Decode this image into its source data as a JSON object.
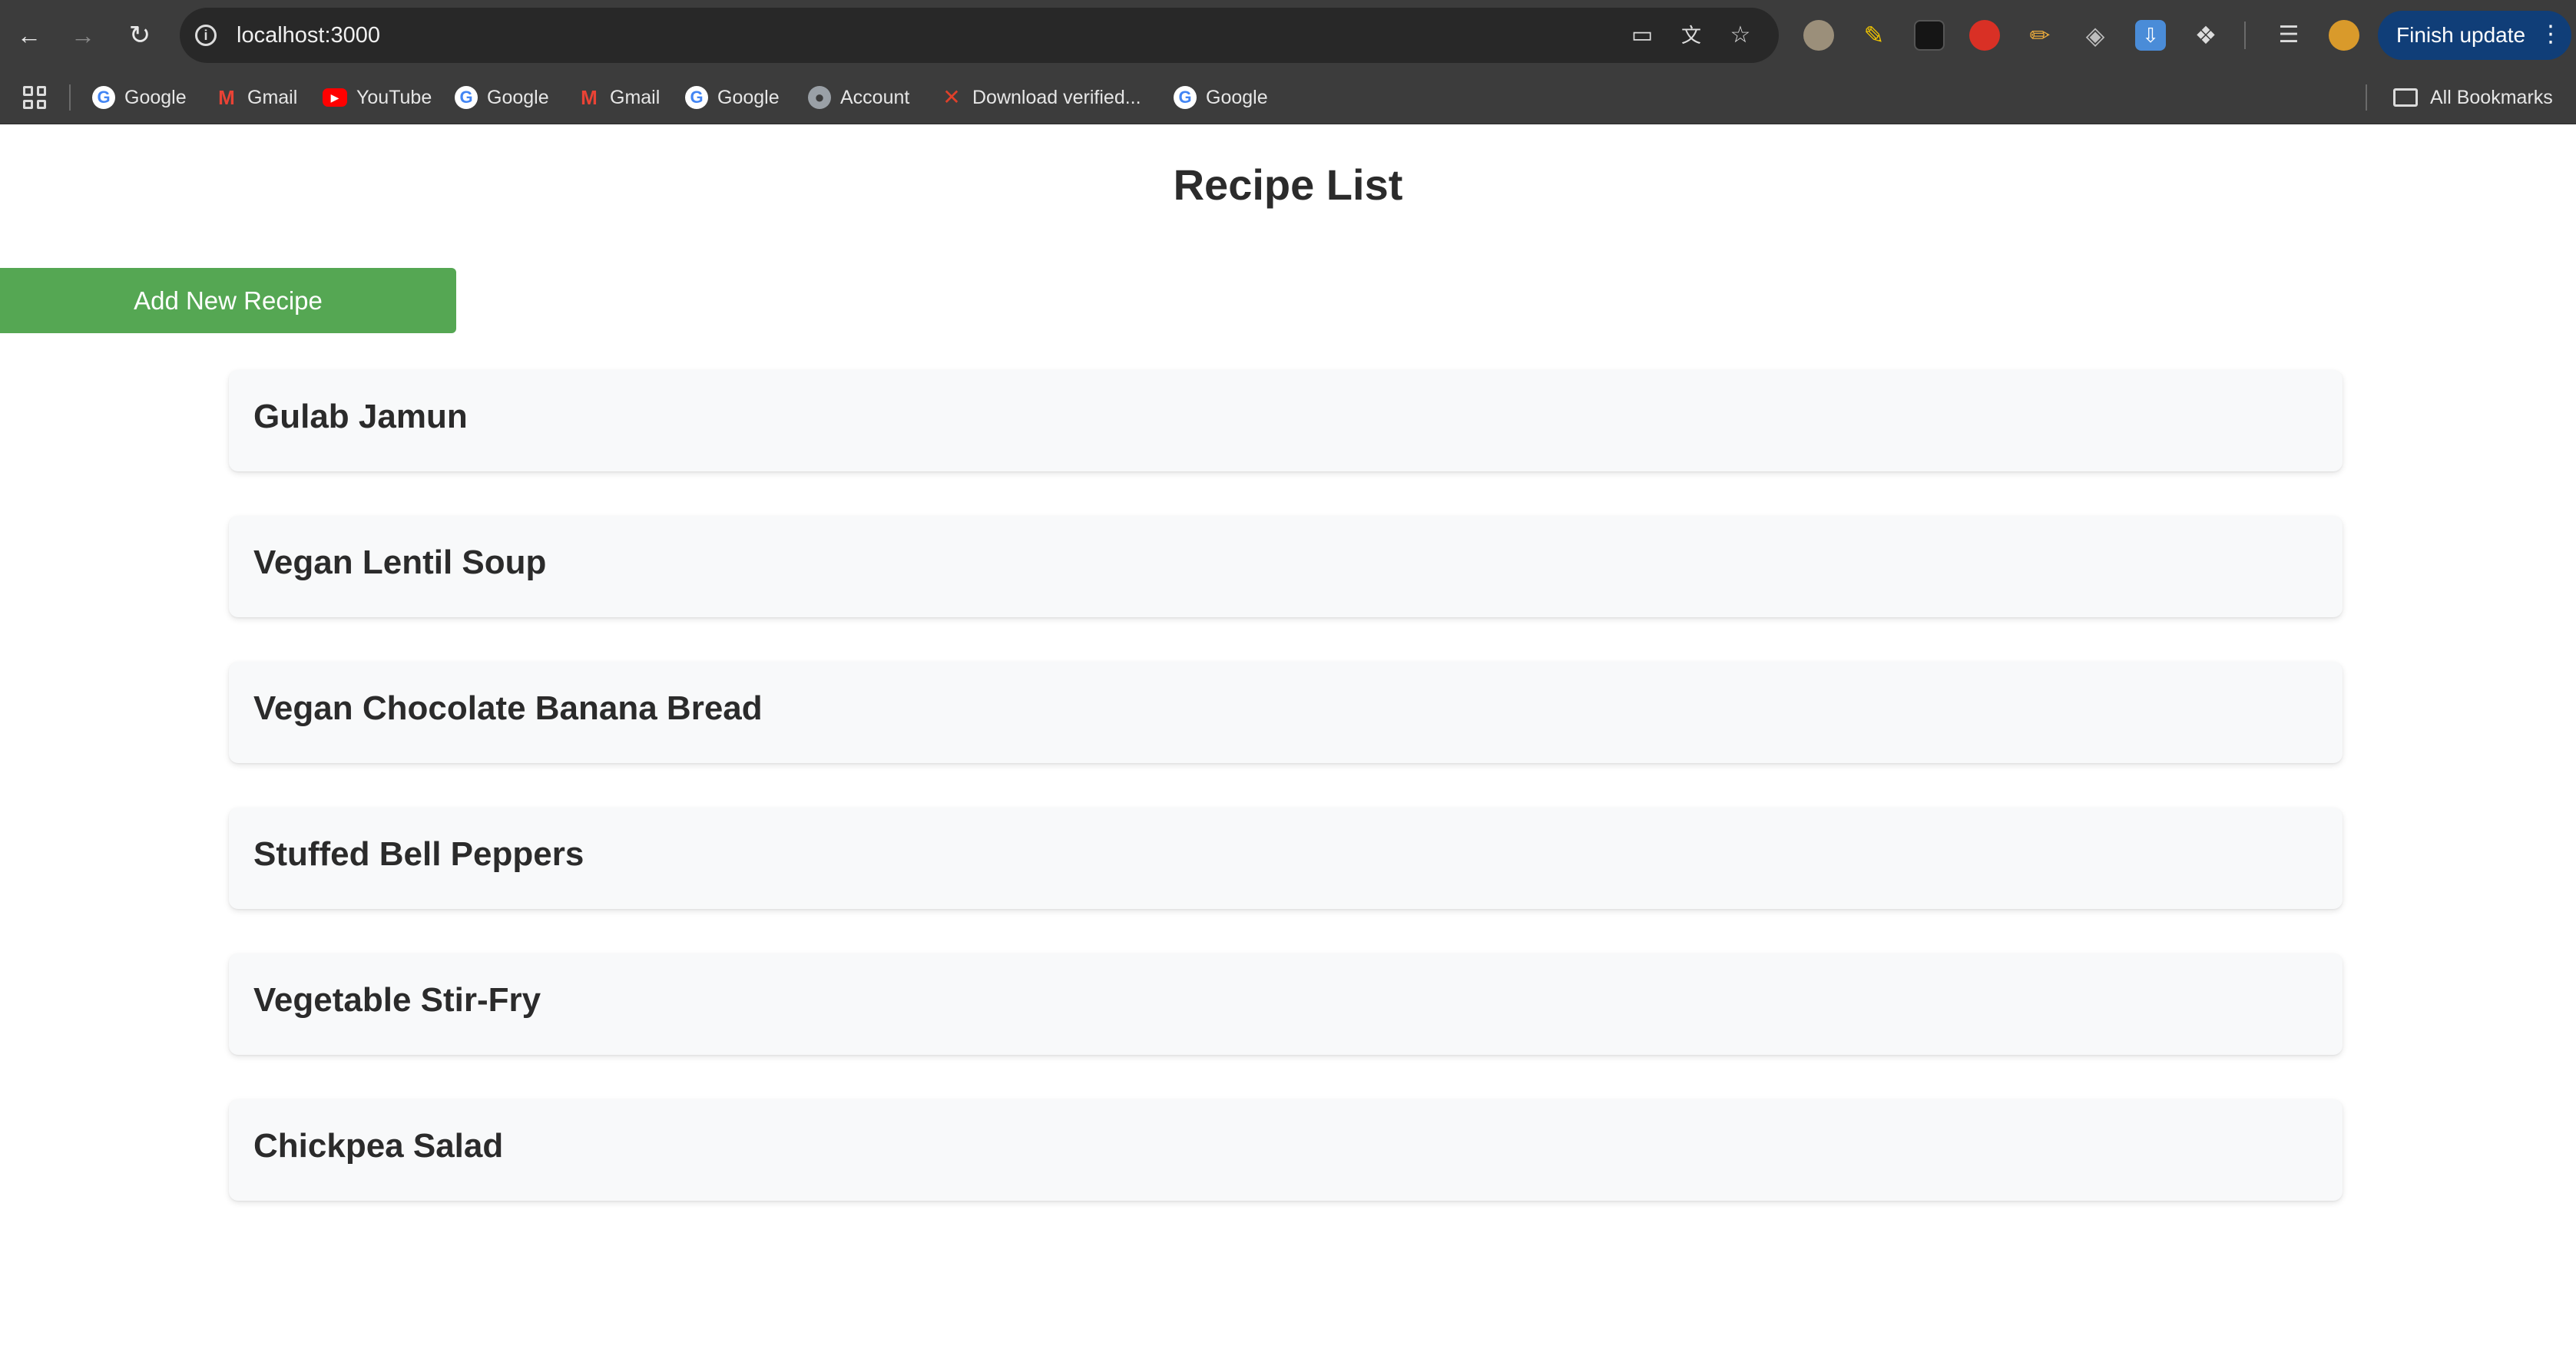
{
  "browser": {
    "url": "localhost:3000",
    "finish_update_label": "Finish update",
    "bookmarks": [
      {
        "label": "Google",
        "icon": "google-icon"
      },
      {
        "label": "Gmail",
        "icon": "gmail-icon"
      },
      {
        "label": "YouTube",
        "icon": "youtube-icon"
      },
      {
        "label": "Google",
        "icon": "google-icon"
      },
      {
        "label": "Gmail",
        "icon": "gmail-icon"
      },
      {
        "label": "Google",
        "icon": "google-icon"
      },
      {
        "label": "Account",
        "icon": "account-icon"
      },
      {
        "label": "Download verified...",
        "icon": "x-logo-icon"
      },
      {
        "label": "Google",
        "icon": "google-icon"
      }
    ],
    "all_bookmarks_label": "All Bookmarks",
    "colors": {
      "toolbar": "#3c3c3c",
      "omnibox": "#282828",
      "finish_update": "#103e78"
    }
  },
  "page": {
    "title": "Recipe List",
    "add_button_label": "Add New Recipe",
    "recipes": [
      "Gulab Jamun",
      "Vegan Lentil Soup",
      "Vegan Chocolate Banana Bread",
      "Stuffed Bell Peppers",
      "Vegetable Stir-Fry",
      "Chickpea Salad"
    ],
    "colors": {
      "add_button": "#55a753",
      "card_background": "#f8f9fa",
      "text": "#2b2b2b"
    }
  }
}
